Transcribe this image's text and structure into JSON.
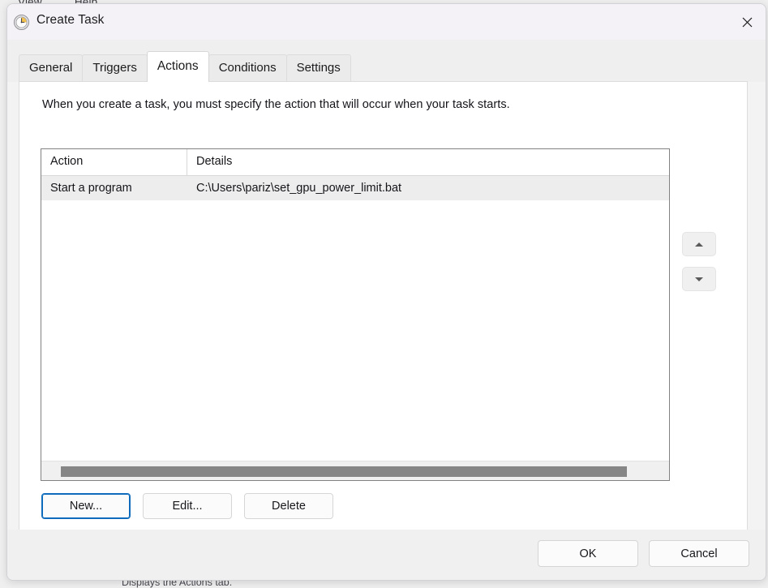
{
  "background_window": {
    "menu_items": [
      "View",
      "Help"
    ],
    "bottom_text": "Displays the Actions tab."
  },
  "dialog": {
    "title": "Create Task",
    "icon": "clock-icon",
    "close_icon": "close-icon",
    "tabs": [
      {
        "label": "General",
        "selected": false
      },
      {
        "label": "Triggers",
        "selected": false
      },
      {
        "label": "Actions",
        "selected": true
      },
      {
        "label": "Conditions",
        "selected": false
      },
      {
        "label": "Settings",
        "selected": false
      }
    ],
    "description": "When you create a task, you must specify the action that will occur when your task starts.",
    "actions_list": {
      "columns": [
        "Action",
        "Details"
      ],
      "rows": [
        {
          "action": "Start a program",
          "details": "C:\\Users\\pariz\\set_gpu_power_limit.bat",
          "selected": true
        }
      ],
      "scroll": {
        "orientation": "horizontal",
        "thumb_percent": 90
      }
    },
    "reorder_buttons": [
      {
        "name": "move-up-button",
        "icon": "arrow-up-icon"
      },
      {
        "name": "move-down-button",
        "icon": "arrow-down-icon"
      }
    ],
    "action_buttons": [
      {
        "label": "New...",
        "focused": true
      },
      {
        "label": "Edit...",
        "focused": false
      },
      {
        "label": "Delete",
        "focused": false
      }
    ],
    "footer_buttons": [
      {
        "label": "OK"
      },
      {
        "label": "Cancel"
      }
    ]
  },
  "colors": {
    "titlebar": "#F5F2F7",
    "tabstrip": "#EFEFEF",
    "page": "#FFFFFF",
    "selected_row": "#EDEDED",
    "scroll_thumb": "#868686",
    "focus_accent": "#0F6CBD",
    "list_border": "#828282"
  }
}
